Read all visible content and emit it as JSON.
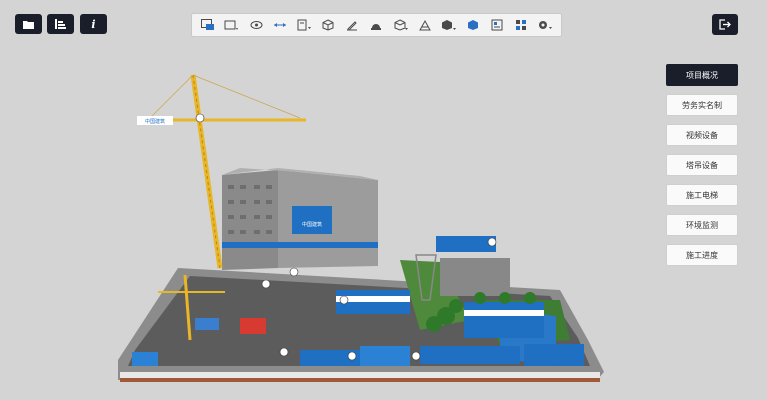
{
  "top_left_buttons": [
    {
      "icon": "folder-icon"
    },
    {
      "icon": "layers-list-icon"
    },
    {
      "icon": "info-icon",
      "glyph": "i"
    }
  ],
  "toolbar": {
    "tools": [
      "image-compare-icon",
      "camera-dropdown-icon",
      "refresh-view-icon",
      "measure-distance-icon",
      "section-dropdown-icon",
      "cube-icon",
      "pen-icon",
      "warning-signal-icon",
      "box-outline-icon",
      "terrain-icon",
      "cube-dropdown-icon",
      "solid-cube-icon",
      "document-icon",
      "grid-icon",
      "settings-dropdown-icon"
    ]
  },
  "exit_button": {
    "icon": "exit-icon"
  },
  "side_menu": {
    "items": [
      {
        "label": "项目概况",
        "active": true
      },
      {
        "label": "劳务实名制",
        "active": false
      },
      {
        "label": "视频设备",
        "active": false
      },
      {
        "label": "塔吊设备",
        "active": false
      },
      {
        "label": "施工电梯",
        "active": false
      },
      {
        "label": "环境监测",
        "active": false
      },
      {
        "label": "施工进度",
        "active": false
      }
    ]
  },
  "scene": {
    "crane_sign": "中国建筑",
    "building_sign": "中国建筑",
    "accent_blue": "#1f6fc2",
    "ground_color": "#5a5a5a",
    "crane_color": "#e8b626"
  }
}
